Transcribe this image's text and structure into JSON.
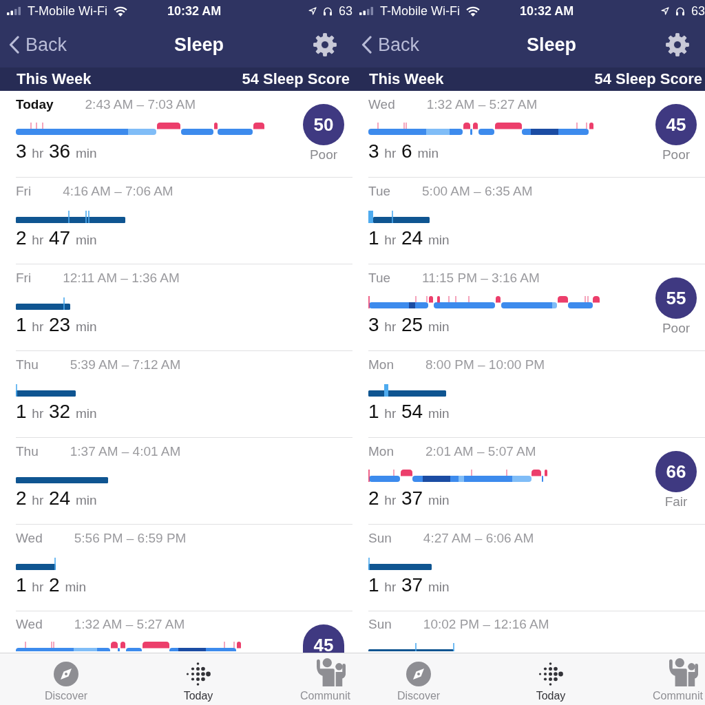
{
  "screens": [
    {
      "status_bar": {
        "carrier": "T-Mobile Wi-Fi",
        "time": "10:32 AM",
        "battery": "63"
      },
      "nav_bar": {
        "back": "Back",
        "title": "Sleep"
      },
      "summary": {
        "period": "This Week",
        "score": "54 Sleep Score"
      },
      "rows": [
        {
          "day": "Today",
          "current": true,
          "time_range": "2:43 AM – 7:03 AM",
          "duration": "3 hr 36 min",
          "score": {
            "value": "50",
            "rating": "Poor"
          }
        },
        {
          "day": "Fri",
          "current": false,
          "time_range": "4:16 AM – 7:06 AM",
          "duration": "2 hr 47 min"
        },
        {
          "day": "Fri",
          "current": false,
          "time_range": "12:11 AM – 1:36 AM",
          "duration": "1 hr 23 min"
        },
        {
          "day": "Thu",
          "current": false,
          "time_range": "5:39 AM – 7:12 AM",
          "duration": "1 hr 32 min"
        },
        {
          "day": "Thu",
          "current": false,
          "time_range": "1:37 AM – 4:01 AM",
          "duration": "2 hr 24 min"
        },
        {
          "day": "Wed",
          "current": false,
          "time_range": "5:56 PM – 6:59 PM",
          "duration": "1 hr 2 min"
        },
        {
          "day": "Wed",
          "current": false,
          "time_range": "1:32 AM – 5:27 AM",
          "score": {
            "value": "45"
          }
        }
      ],
      "tab_bar": [
        {
          "label": "Discover",
          "selected": false
        },
        {
          "label": "Today",
          "selected": true
        },
        {
          "label": "Communit",
          "selected": false
        }
      ]
    },
    {
      "status_bar": {
        "carrier": "T-Mobile Wi-Fi",
        "time": "10:32 AM",
        "battery": "63"
      },
      "nav_bar": {
        "back": "Back",
        "title": "Sleep"
      },
      "summary": {
        "period": "This Week",
        "score": "54 Sleep Score"
      },
      "rows": [
        {
          "day": "Wed",
          "current": false,
          "time_range": "1:32 AM – 5:27 AM",
          "duration": "3 hr 6 min",
          "score": {
            "value": "45",
            "rating": "Poor"
          }
        },
        {
          "day": "Tue",
          "current": false,
          "time_range": "5:00 AM – 6:35 AM",
          "duration": "1 hr 24 min"
        },
        {
          "day": "Tue",
          "current": false,
          "time_range": "11:15 PM – 3:16 AM",
          "duration": "3 hr 25 min",
          "score": {
            "value": "55",
            "rating": "Poor"
          }
        },
        {
          "day": "Mon",
          "current": false,
          "time_range": "8:00 PM – 10:00 PM",
          "duration": "1 hr 54 min"
        },
        {
          "day": "Mon",
          "current": false,
          "time_range": "2:01 AM – 5:07 AM",
          "duration": "2 hr 37 min",
          "score": {
            "value": "66",
            "rating": "Fair"
          }
        },
        {
          "day": "Sun",
          "current": false,
          "time_range": "4:27 AM – 6:06 AM",
          "duration": "1 hr 37 min"
        },
        {
          "day": "Sun",
          "current": false,
          "time_range": "10:02 PM – 12:16 AM"
        }
      ],
      "tab_bar": [
        {
          "label": "Discover",
          "selected": false
        },
        {
          "label": "Today",
          "selected": true
        },
        {
          "label": "Communit",
          "selected": false
        }
      ]
    }
  ]
}
